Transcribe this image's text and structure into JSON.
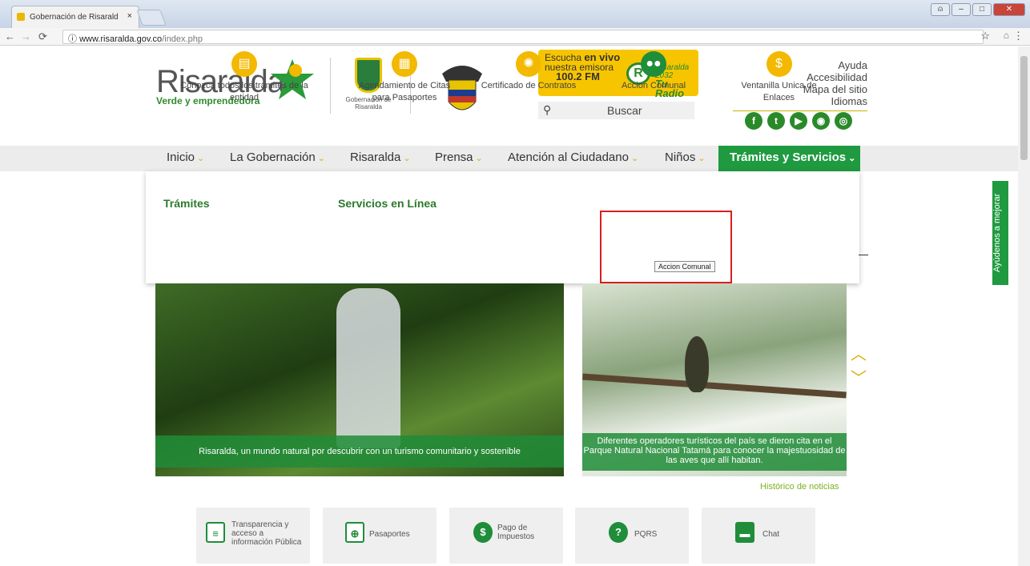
{
  "browser": {
    "tab_title": "Gobernación de Risarald",
    "tab_close": "×",
    "url_host": "www.risaralda.gov.co",
    "url_path": "/index.php",
    "info_icon": "ⓘ"
  },
  "header": {
    "logo_name": "Risaralda",
    "logo_tagline": "Verde y emprendedora",
    "gob_label": "Gobernación de Risaralda",
    "radio_line1_pre": "Escucha ",
    "radio_line1_bold": "en vivo",
    "radio_line2": "nuestra emisora",
    "radio_line3": "100.2 FM",
    "radio_brand": "Risaralda 2032",
    "radio_slogan": "Tu Radio",
    "search_placeholder": "Buscar",
    "links": [
      "Ayuda",
      "Accesibilidad",
      "Mapa del sitio",
      "Idiomas"
    ],
    "social": [
      "f",
      "t",
      "▶",
      "◉",
      "◎"
    ]
  },
  "nav": {
    "items": [
      "Inicio",
      "La Gobernación",
      "Risaralda",
      "Prensa",
      "Atención al Ciudadano",
      "Niños"
    ],
    "active": "Trámites y Servicios",
    "chevron": "⌄"
  },
  "dropdown": {
    "heading_tramites": "Trámites",
    "heading_servicios": "Servicios en Línea",
    "services": [
      {
        "label1": "Conozca todos los trámites de la",
        "label2": "entidad",
        "icon": "document-icon"
      },
      {
        "label1": "Agendamiento de Citas",
        "label2": "para Pasaportes",
        "icon": "calendar-icon"
      },
      {
        "label1": "Certificado de Contratos",
        "label2": "",
        "icon": "badge-icon"
      },
      {
        "label1": "Accion Comunal",
        "label2": "",
        "icon": "people-icon"
      },
      {
        "label1": "Ventanilla Unica de",
        "label2": "Enlaces",
        "icon": "money-icon"
      }
    ],
    "tooltip": "Accion Comunal"
  },
  "side_tab": "Ayúdenos a mejorar",
  "slider": {
    "caption1": "Risaralda, un mundo natural por descubrir con un turismo comunitario y sostenible",
    "caption2": "Diferentes operadores turísticos del país se dieron cita en el Parque Natural Nacional Tatamá para conocer la majestuosidad de las aves que allí habitan.",
    "up": "︿",
    "down": "﹀"
  },
  "history_link": "Histórico de noticias",
  "quick_links": [
    {
      "label": "Transparencia y acceso a información Pública",
      "icon": "document-list-icon",
      "glyph": "≡"
    },
    {
      "label": "Pasaportes",
      "icon": "globe-icon",
      "glyph": "⊕"
    },
    {
      "label": "Pago de Impuestos",
      "icon": "dollar-icon",
      "glyph": "$"
    },
    {
      "label": "PQRS",
      "icon": "question-icon",
      "glyph": "?"
    },
    {
      "label": "Chat",
      "icon": "chat-icon",
      "glyph": "▬"
    }
  ]
}
